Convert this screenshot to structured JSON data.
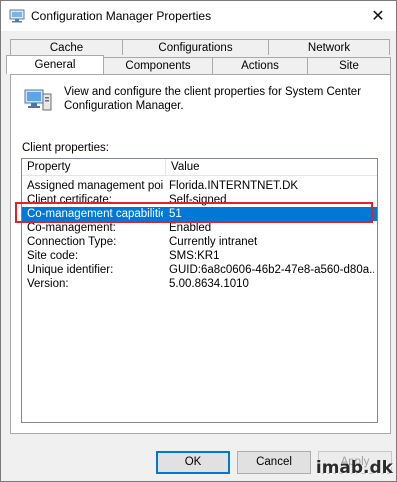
{
  "window": {
    "title": "Configuration Manager Properties",
    "close_symbol": "✕"
  },
  "tabs": {
    "back_row": [
      "Cache",
      "Configurations",
      "Network"
    ],
    "front_row": [
      "General",
      "Components",
      "Actions",
      "Site"
    ],
    "active": "General"
  },
  "panel": {
    "info_text": "View and configure the client properties for System Center Configuration Manager.",
    "group_label": "Client properties:",
    "columns": [
      "Property",
      "Value"
    ],
    "rows": [
      {
        "property": "Assigned management poi...",
        "value": "Florida.INTERNTNET.DK"
      },
      {
        "property": "Client certificate:",
        "value": "Self-signed"
      },
      {
        "property": "Co-management capabilities:",
        "value": "51",
        "selected": true
      },
      {
        "property": "Co-management:",
        "value": "Enabled"
      },
      {
        "property": "Connection Type:",
        "value": "Currently intranet"
      },
      {
        "property": "Site code:",
        "value": "SMS:KR1"
      },
      {
        "property": "Unique identifier:",
        "value": "GUID:6a8c0606-46b2-47e8-a560-d80a..."
      },
      {
        "property": "Version:",
        "value": "5.00.8634.1010"
      }
    ]
  },
  "buttons": {
    "ok": "OK",
    "cancel": "Cancel",
    "apply": "Apply"
  },
  "watermark": "imab.dk",
  "colors": {
    "selection": "#0078d7",
    "highlight_box": "#d9262e"
  }
}
